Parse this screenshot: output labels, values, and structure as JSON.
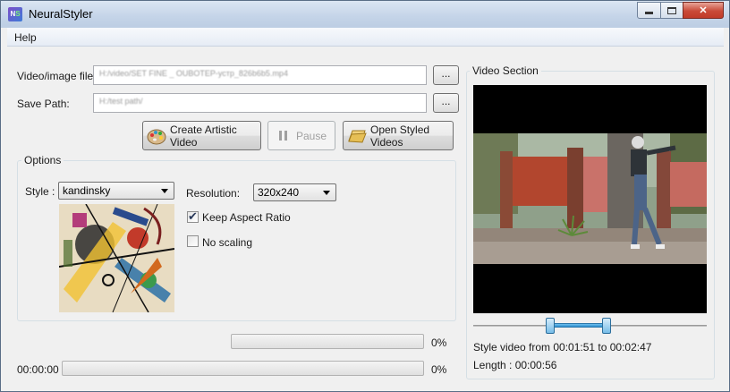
{
  "window": {
    "title": "NeuralStyler",
    "icon": "NS-app-icon",
    "minimize": "minimize",
    "maximize": "maximize",
    "close": "close"
  },
  "menu": {
    "items": [
      "Help"
    ]
  },
  "files": {
    "video_label": "Video/image file:",
    "video_value": "H:/video/SET FINE _ OUBOTEP-устр_826b6b5.mp4",
    "save_label": "Save Path:",
    "save_value": "H:/test path/",
    "browse_label": "..."
  },
  "actions": {
    "create": "Create Artistic Video",
    "pause": "Pause",
    "open": "Open Styled Videos"
  },
  "options": {
    "title": "Options",
    "style_label": "Style :",
    "style_value": "kandinsky",
    "resolution_label": "Resolution:",
    "resolution_value": "320x240",
    "keep_aspect_label": "Keep Aspect Ratio",
    "keep_aspect_checked": true,
    "no_scaling_label": "No scaling",
    "no_scaling_checked": false
  },
  "progress": {
    "style_percent_text": "0%",
    "style_fraction": 0,
    "video_time": "00:00:00",
    "video_percent_text": "0%",
    "video_fraction": 0
  },
  "video_section": {
    "title": "Video Section",
    "range_text": "Style video from 00:01:51 to 00:02:47",
    "length_text": "Length : 00:00:56",
    "range_start_fraction": 0.33,
    "range_end_fraction": 0.57
  },
  "colors": {
    "window_bg": "#f0f0f0",
    "titlebar": "#c4d4e8",
    "close_button": "#c94a38",
    "slider_blue": "#2d8ecf",
    "progress_green": "#2fb32f"
  }
}
